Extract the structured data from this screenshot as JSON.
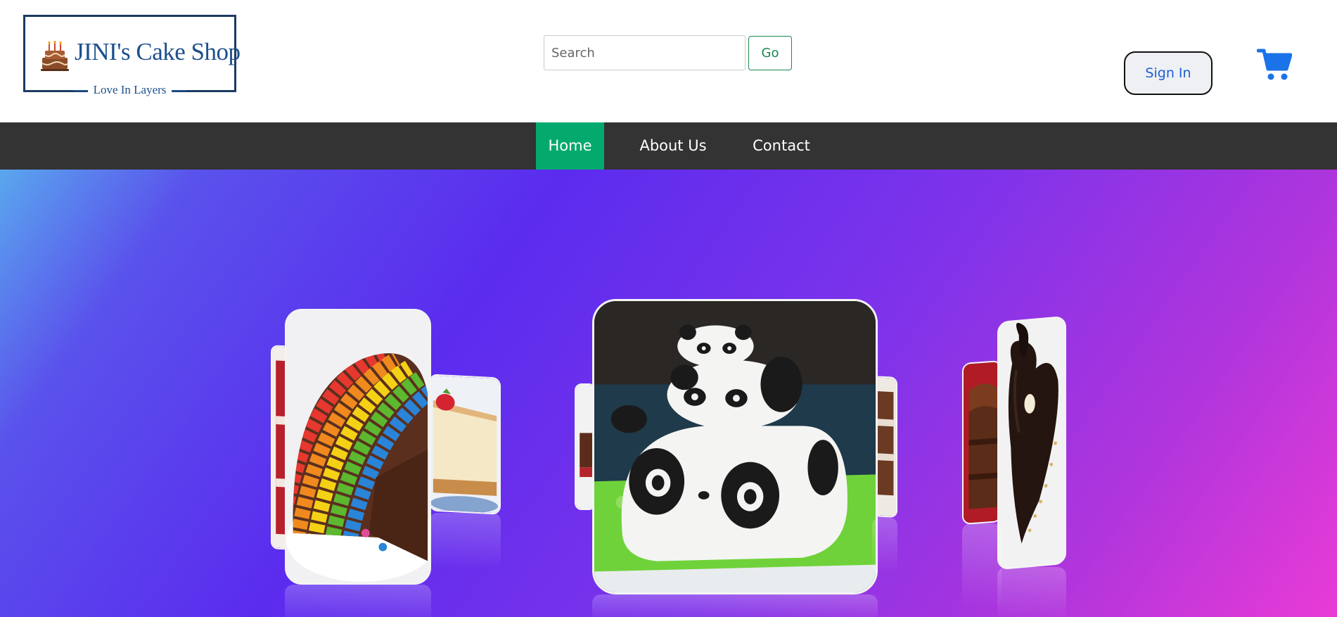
{
  "header": {
    "logo": {
      "name": "JINI's Cake Shop",
      "tagline": "Love In Layers"
    },
    "search": {
      "placeholder": "Search",
      "value": "",
      "button_label": "Go"
    },
    "signin_label": "Sign In",
    "cart_icon": "cart-icon"
  },
  "nav": {
    "items": [
      {
        "label": "Home",
        "active": true
      },
      {
        "label": "About Us",
        "active": false
      },
      {
        "label": "Contact",
        "active": false
      }
    ]
  },
  "carousel": {
    "slides": [
      "rainbow-gems-cake",
      "cheesecake-slice",
      "panda-cake",
      "chocolate-heart-cake",
      "chocolate-pastry"
    ]
  },
  "colors": {
    "nav_bg": "#333333",
    "nav_active": "#04aa6d",
    "go_button": "#198754",
    "brand_blue": "#1d4f8c",
    "cart_blue": "#1a73e8",
    "hero_gradient": [
      "#5aa7ee",
      "#5b2cee",
      "#b035dc",
      "#e93bd6"
    ]
  }
}
